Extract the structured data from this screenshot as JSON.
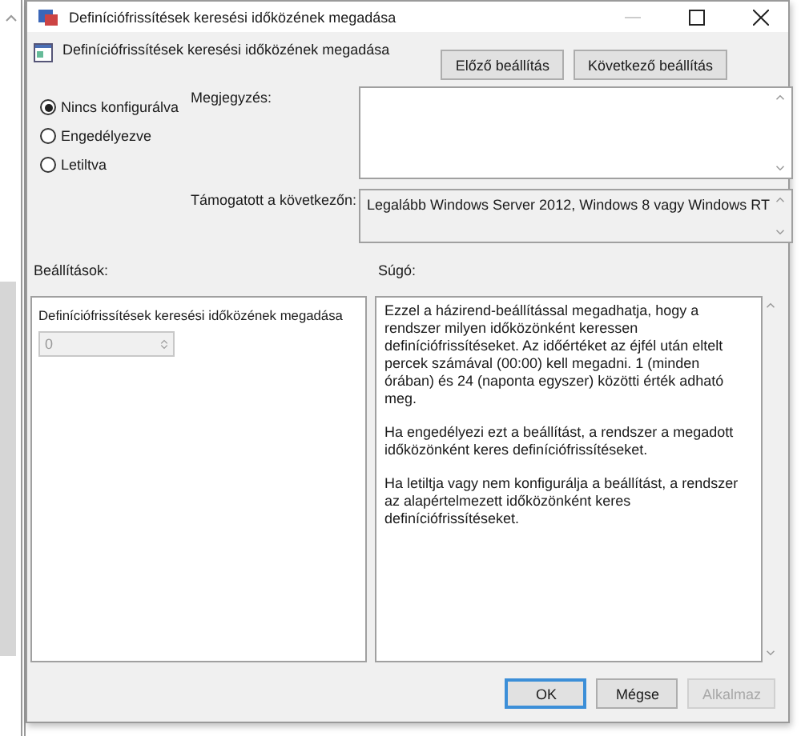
{
  "window": {
    "title": "Definíciófrissítések keresési időközének megadása"
  },
  "header": {
    "policy_title": "Definíciófrissítések keresési időközének megadása",
    "buttons": [
      {
        "label": "Előző beállítás"
      },
      {
        "label": "Következő beállítás"
      }
    ]
  },
  "options": [
    {
      "label": "Nincs konfigurálva",
      "selected": true
    },
    {
      "label": "Engedélyezve",
      "selected": false
    },
    {
      "label": "Letiltva",
      "selected": false
    }
  ],
  "comment": {
    "label": "Megjegyzés:"
  },
  "supported": {
    "label": "Támogatott a következőn:",
    "value": "Legalább Windows Server 2012, Windows 8 vagy Windows RT"
  },
  "settings": {
    "label": "Beállítások:",
    "option_label": "Definíciófrissítések keresési időközének megadása",
    "value": "0",
    "disabled": true
  },
  "help": {
    "label": "Súgó:",
    "paragraphs": [
      "Ezzel a házirend-beállítással megadhatja, hogy a rendszer milyen időközönként keressen definíciófrissítéseket. Az időértéket az éjfél után eltelt percek számával (00:00) kell megadni. 1 (minden órában) és 24 (naponta egyszer) közötti érték adható meg.",
      "Ha engedélyezi ezt a beállítást, a rendszer a megadott időközönként keres definíciófrissítéseket.",
      "Ha letiltja vagy nem konfigurálja a beállítást, a rendszer az alapértelmezett időközönként keres definíciófrissítéseket."
    ]
  },
  "buttons": [
    {
      "label": "OK",
      "default": true,
      "disabled": false
    },
    {
      "label": "Mégse",
      "default": false,
      "disabled": false
    },
    {
      "label": "Alkalmaz",
      "default": false,
      "disabled": true
    }
  ]
}
